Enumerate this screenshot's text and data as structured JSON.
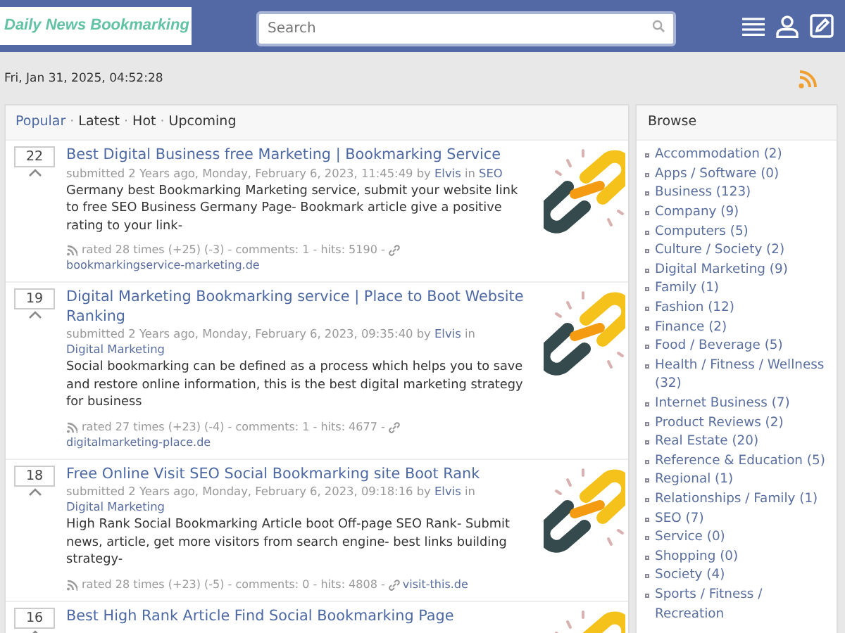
{
  "header": {
    "logo": "Daily News Bookmarking",
    "search": {
      "placeholder": "Search"
    }
  },
  "date": "Fri, Jan 31, 2025, 04:52:28",
  "tab_separator": "·",
  "tabs": [
    {
      "label": "Popular",
      "selected": true
    },
    {
      "label": "Latest",
      "selected": false
    },
    {
      "label": "Hot",
      "selected": false
    },
    {
      "label": "Upcoming",
      "selected": false
    }
  ],
  "posts": [
    {
      "votes": "22",
      "title": "Best Digital Business free Marketing | Bookmarking Service",
      "meta": "submitted 2 Years ago, Monday, February 6, 2023, 11:45:49 by",
      "author": "Elvis",
      "in": "in",
      "category": "SEO",
      "text": "Germany best Bookmarking Marketing service, submit your website link to free SEO Business Germany Page- Bookmark article give a positive rating to your link-",
      "stats": "rated 28 times (+25)  (-3) - comments: 1 - hits: 5190 -",
      "domain": "bookmarkingservice-marketing.de"
    },
    {
      "votes": "19",
      "title": "Digital Marketing Bookmarking service | Place to Boot Website Ranking",
      "meta": "submitted 2 Years ago, Monday, February 6, 2023, 09:35:40 by",
      "author": "Elvis",
      "in": "in",
      "category": "Digital Marketing",
      "text": "Social bookmarking can be defined as a process which helps you to save and restore online information, this is the best digital marketing strategy for business",
      "stats": "rated 27 times (+23)  (-4) - comments: 1 - hits: 4677 -",
      "domain": "digitalmarketing-place.de"
    },
    {
      "votes": "18",
      "title": "Free Online Visit SEO Social Bookmarking site Boot Rank",
      "meta": "submitted 2 Years ago, Monday, February 6, 2023, 09:18:16 by",
      "author": "Elvis",
      "in": "in",
      "category": "Digital Marketing",
      "text": "High Rank Social Bookmarking Article boot Off-page SEO Rank- Submit news, article, get more visitors from search engine- best links building strategy-",
      "stats": "rated 28 times (+23)  (-5) - comments: 0 - hits: 4808 -",
      "domain": "visit-this.de"
    },
    {
      "votes": "16",
      "title": "Best High Rank Article Find Social Bookmarking Page"
    }
  ],
  "sidebar": {
    "title": "Browse",
    "items": [
      "Accommodation (2)",
      "Apps / Software (0)",
      "Business (123)",
      "Company (9)",
      "Computers (5)",
      "Culture / Society (2)",
      "Digital Marketing (9)",
      "Family (1)",
      "Fashion (12)",
      "Finance (2)",
      "Food / Beverage (5)",
      "Health / Fitness / Wellness (32)",
      "Internet Business (7)",
      "Product Reviews (2)",
      "Real Estate (20)",
      "Reference & Education (5)",
      "Regional (1)",
      "Relationships / Family (1)",
      "SEO (7)",
      "Service (0)",
      "Shopping (0)",
      "Society (4)",
      "Sports / Fitness / Recreation"
    ]
  }
}
